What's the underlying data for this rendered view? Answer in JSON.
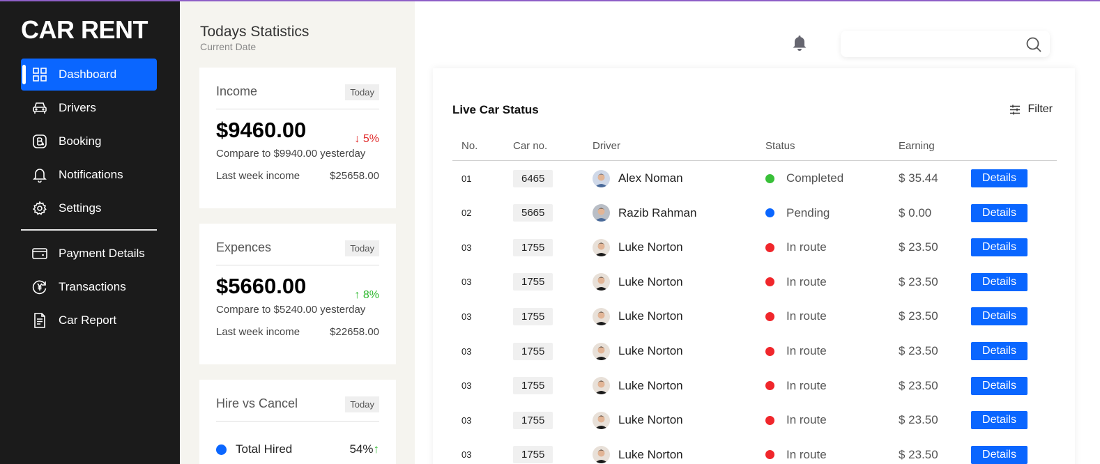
{
  "app": {
    "logo": "CAR RENT"
  },
  "sidebar": {
    "items": [
      {
        "label": "Dashboard",
        "icon": "grid-icon",
        "active": true
      },
      {
        "label": "Drivers",
        "icon": "car-icon"
      },
      {
        "label": "Booking",
        "icon": "booking-icon"
      },
      {
        "label": "Notifications",
        "icon": "bell-icon"
      },
      {
        "label": "Settings",
        "icon": "gear-icon"
      },
      {
        "label": "Payment Details",
        "icon": "wallet-icon"
      },
      {
        "label": "Transactions",
        "icon": "yen-icon"
      },
      {
        "label": "Car Report",
        "icon": "document-icon"
      }
    ]
  },
  "stats": {
    "title": "Todays Statistics",
    "subtitle": "Current Date",
    "income": {
      "title": "Income",
      "badge": "Today",
      "amount": "$9460.00",
      "change": "↓ 5%",
      "compare": "Compare to $9940.00 yesterday",
      "last_week_label": "Last week income",
      "last_week_value": "$25658.00"
    },
    "expenses": {
      "title": "Expences",
      "badge": "Today",
      "amount": "$5660.00",
      "change": "↑ 8%",
      "compare": "Compare to $5240.00 yesterday",
      "last_week_label": "Last week income",
      "last_week_value": "$22658.00"
    },
    "hire": {
      "title": "Hire vs Cancel",
      "badge": "Today",
      "total_hired_label": "Total Hired",
      "total_hired_value": "54%",
      "total_hired_arrow": "↑"
    }
  },
  "search": {
    "placeholder": ""
  },
  "live": {
    "title": "Live Car Status",
    "filter_label": "Filter",
    "columns": [
      "No.",
      "Car no.",
      "Driver",
      "Status",
      "Earning"
    ],
    "details_label": "Details",
    "status_colors": {
      "Completed": "#38c038",
      "Pending": "#0a66ff",
      "In route": "#f0262b"
    },
    "rows": [
      {
        "no": "01",
        "car": "6465",
        "driver": "Alex Noman",
        "status": "Completed",
        "earning": "$ 35.44"
      },
      {
        "no": "02",
        "car": "5665",
        "driver": "Razib Rahman",
        "status": "Pending",
        "earning": "$ 0.00"
      },
      {
        "no": "03",
        "car": "1755",
        "driver": "Luke Norton",
        "status": "In route",
        "earning": "$ 23.50"
      },
      {
        "no": "03",
        "car": "1755",
        "driver": "Luke Norton",
        "status": "In route",
        "earning": "$ 23.50"
      },
      {
        "no": "03",
        "car": "1755",
        "driver": "Luke Norton",
        "status": "In route",
        "earning": "$ 23.50"
      },
      {
        "no": "03",
        "car": "1755",
        "driver": "Luke Norton",
        "status": "In route",
        "earning": "$ 23.50"
      },
      {
        "no": "03",
        "car": "1755",
        "driver": "Luke Norton",
        "status": "In route",
        "earning": "$ 23.50"
      },
      {
        "no": "03",
        "car": "1755",
        "driver": "Luke Norton",
        "status": "In route",
        "earning": "$ 23.50"
      },
      {
        "no": "03",
        "car": "1755",
        "driver": "Luke Norton",
        "status": "In route",
        "earning": "$ 23.50"
      }
    ]
  }
}
